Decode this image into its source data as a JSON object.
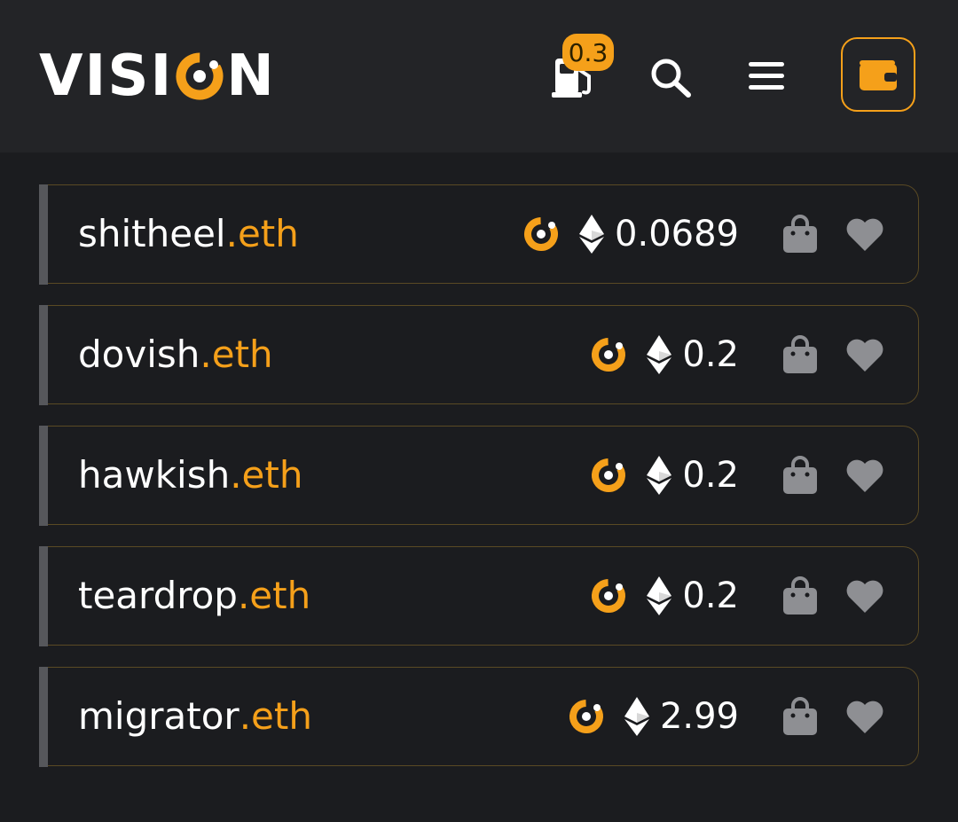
{
  "header": {
    "logo": {
      "text_left": "VISI",
      "text_right": "N"
    },
    "gas": {
      "value": "0.3",
      "icon": "gas-pump-icon"
    },
    "icons": {
      "search": "search-icon",
      "menu": "hamburger-menu-icon",
      "wallet": "wallet-icon"
    }
  },
  "colors": {
    "accent": "#f5a01a",
    "background": "#1b1c1f",
    "header": "#232427",
    "muted_icon": "#8e8f93"
  },
  "listings": [
    {
      "name": "shitheel",
      "tld": ".eth",
      "price": "0.0689"
    },
    {
      "name": "dovish",
      "tld": ".eth",
      "price": "0.2"
    },
    {
      "name": "hawkish",
      "tld": ".eth",
      "price": "0.2"
    },
    {
      "name": "teardrop",
      "tld": ".eth",
      "price": "0.2"
    },
    {
      "name": "migrator",
      "tld": ".eth",
      "price": "2.99"
    }
  ]
}
